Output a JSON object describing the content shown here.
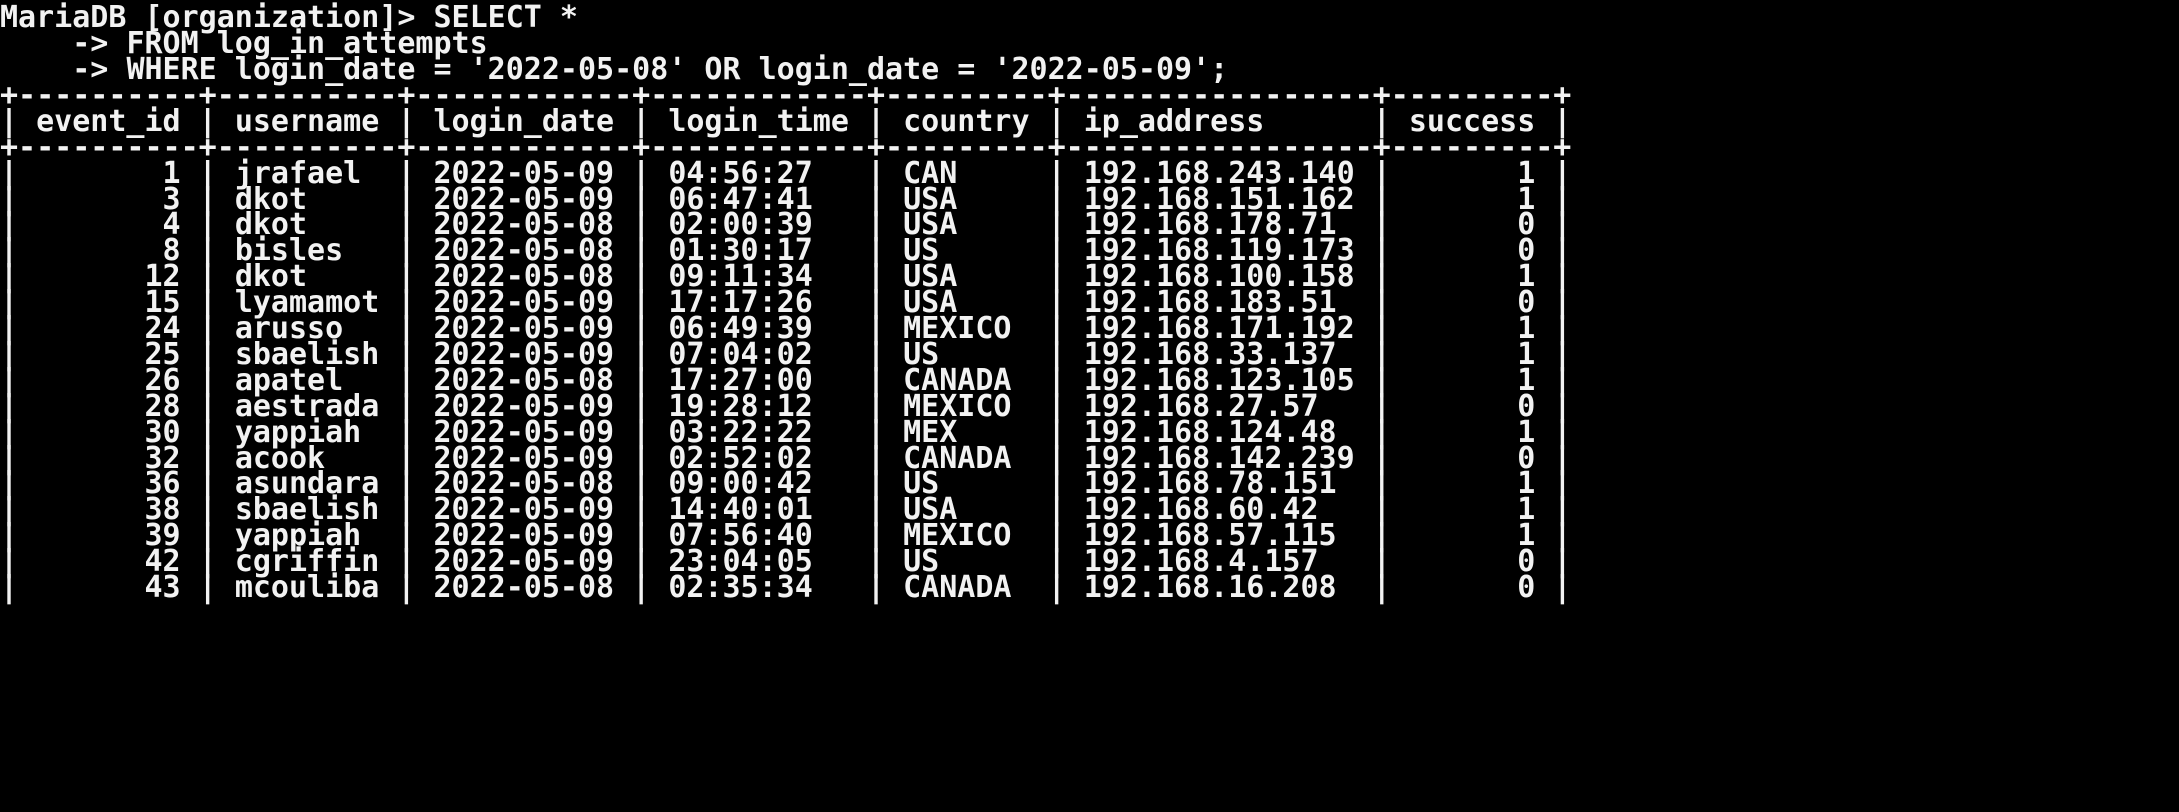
{
  "terminal": {
    "prompt": "MariaDB [organization]> ",
    "continuation_prompt": "    -> ",
    "query_lines": [
      "SELECT *",
      "FROM log_in_attempts",
      "WHERE login_date = '2022-05-08' OR login_date = '2022-05-09';"
    ]
  },
  "table": {
    "columns": [
      "event_id",
      "username",
      "login_date",
      "login_time",
      "country",
      "ip_address",
      "success"
    ],
    "rows": [
      [
        "1",
        "jrafael",
        "2022-05-09",
        "04:56:27",
        "CAN",
        "192.168.243.140",
        "1"
      ],
      [
        "3",
        "dkot",
        "2022-05-09",
        "06:47:41",
        "USA",
        "192.168.151.162",
        "1"
      ],
      [
        "4",
        "dkot",
        "2022-05-08",
        "02:00:39",
        "USA",
        "192.168.178.71",
        "0"
      ],
      [
        "8",
        "bisles",
        "2022-05-08",
        "01:30:17",
        "US",
        "192.168.119.173",
        "0"
      ],
      [
        "12",
        "dkot",
        "2022-05-08",
        "09:11:34",
        "USA",
        "192.168.100.158",
        "1"
      ],
      [
        "15",
        "lyamamot",
        "2022-05-09",
        "17:17:26",
        "USA",
        "192.168.183.51",
        "0"
      ],
      [
        "24",
        "arusso",
        "2022-05-09",
        "06:49:39",
        "MEXICO",
        "192.168.171.192",
        "1"
      ],
      [
        "25",
        "sbaelish",
        "2022-05-09",
        "07:04:02",
        "US",
        "192.168.33.137",
        "1"
      ],
      [
        "26",
        "apatel",
        "2022-05-08",
        "17:27:00",
        "CANADA",
        "192.168.123.105",
        "1"
      ],
      [
        "28",
        "aestrada",
        "2022-05-09",
        "19:28:12",
        "MEXICO",
        "192.168.27.57",
        "0"
      ],
      [
        "30",
        "yappiah",
        "2022-05-09",
        "03:22:22",
        "MEX",
        "192.168.124.48",
        "1"
      ],
      [
        "32",
        "acook",
        "2022-05-09",
        "02:52:02",
        "CANADA",
        "192.168.142.239",
        "0"
      ],
      [
        "36",
        "asundara",
        "2022-05-08",
        "09:00:42",
        "US",
        "192.168.78.151",
        "1"
      ],
      [
        "38",
        "sbaelish",
        "2022-05-09",
        "14:40:01",
        "USA",
        "192.168.60.42",
        "1"
      ],
      [
        "39",
        "yappiah",
        "2022-05-09",
        "07:56:40",
        "MEXICO",
        "192.168.57.115",
        "1"
      ],
      [
        "42",
        "cgriffin",
        "2022-05-09",
        "23:04:05",
        "US",
        "192.168.4.157",
        "0"
      ],
      [
        "43",
        "mcouliba",
        "2022-05-08",
        "02:35:34",
        "CANADA",
        "192.168.16.208",
        "0"
      ]
    ]
  }
}
